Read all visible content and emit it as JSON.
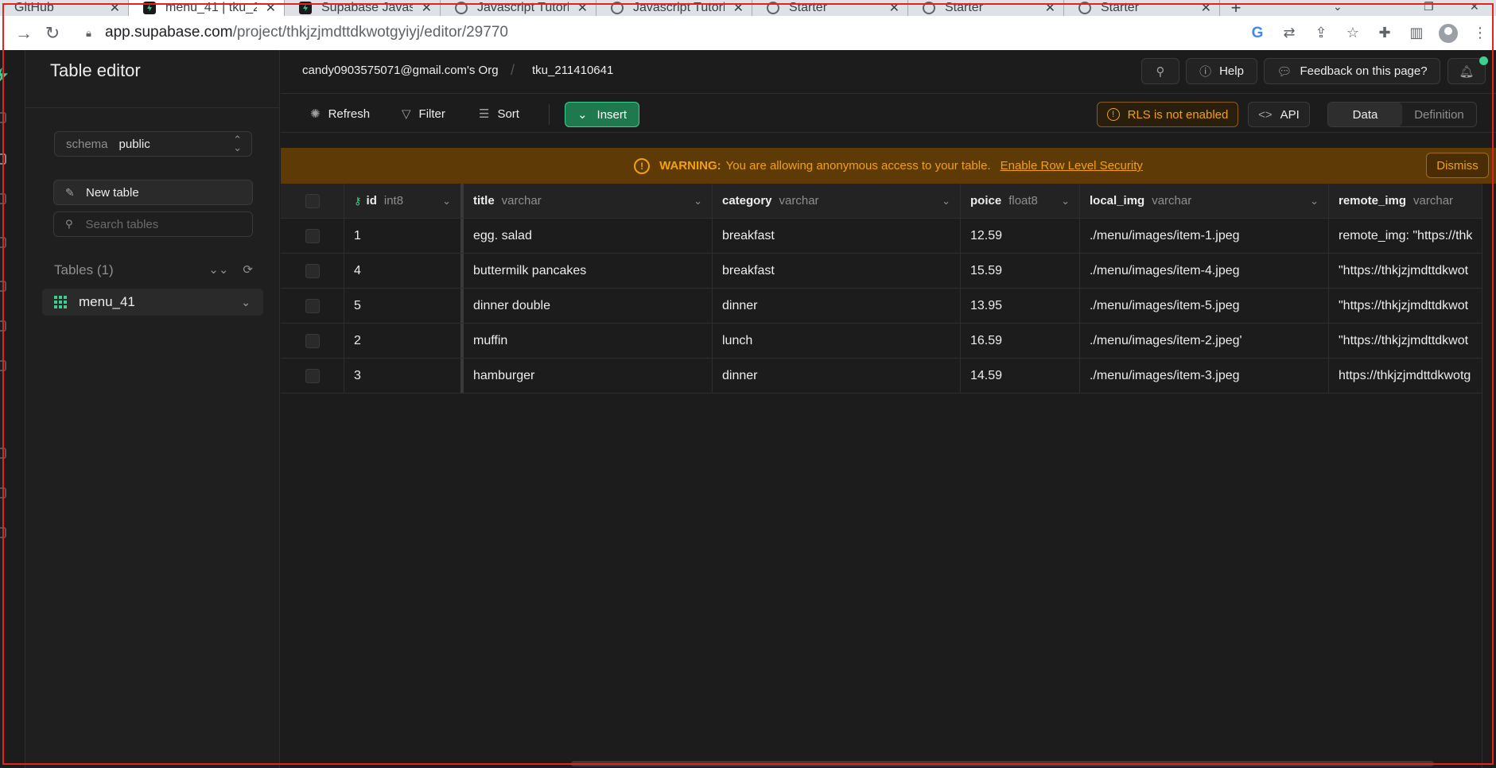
{
  "browser": {
    "tabs": [
      {
        "label": "GitHub",
        "icon": "github-icon"
      },
      {
        "label": "menu_41 | tku_2",
        "icon": "supabase-icon"
      },
      {
        "label": "Supabase Javasc",
        "icon": "supabase-icon"
      },
      {
        "label": "Javascript Tutori",
        "icon": "globe-icon"
      },
      {
        "label": "Javascript Tutori",
        "icon": "globe-icon"
      },
      {
        "label": "Starter",
        "icon": "globe-icon"
      },
      {
        "label": "Starter",
        "icon": "globe-icon"
      },
      {
        "label": "Starter",
        "icon": "globe-icon"
      }
    ],
    "active_tab": 1,
    "url_host": "app.supabase.com",
    "url_path": "/project/thkjzjmdttdkwotgyiyj/editor/29770"
  },
  "sidebar": {
    "title": "Table editor",
    "schema_key": "schema",
    "schema_value": "public",
    "new_table_label": "New table",
    "search_placeholder": "Search tables",
    "tables_heading": "Tables (1)",
    "tables": [
      {
        "name": "menu_41"
      }
    ]
  },
  "topbar": {
    "org": "candy0903575071@gmail.com's Org",
    "separator": "/",
    "project": "tku_211410641",
    "help_label": "Help",
    "feedback_label": "Feedback on this page?"
  },
  "actions": {
    "refresh_label": "Refresh",
    "filter_label": "Filter",
    "sort_label": "Sort",
    "insert_label": "Insert",
    "rls_label": "RLS is not enabled",
    "api_label": "API",
    "view_data": "Data",
    "view_definition": "Definition"
  },
  "warning": {
    "strong": "WARNING:",
    "message": "You are allowing anonymous access to your table.",
    "link": "Enable Row Level Security",
    "dismiss_label": "Dismiss"
  },
  "columns": [
    {
      "name": "id",
      "type": "int8"
    },
    {
      "name": "title",
      "type": "varchar"
    },
    {
      "name": "category",
      "type": "varchar"
    },
    {
      "name": "poice",
      "type": "float8"
    },
    {
      "name": "local_img",
      "type": "varchar"
    },
    {
      "name": "remote_img",
      "type": "varchar"
    }
  ],
  "rows": [
    [
      "1",
      "egg. salad",
      "breakfast",
      "12.59",
      "./menu/images/item-1.jpeg",
      "remote_img: \"https://thk"
    ],
    [
      "4",
      "buttermilk pancakes",
      "breakfast",
      "15.59",
      "./menu/images/item-4.jpeg",
      "\"https://thkjzjmdttdkwot"
    ],
    [
      "5",
      "dinner double",
      "dinner",
      "13.95",
      "./menu/images/item-5.jpeg",
      "\"https://thkjzjmdttdkwot"
    ],
    [
      "2",
      "muffin",
      "lunch",
      "16.59",
      "./menu/images/item-2.jpeg'",
      "\"https://thkjzjmdttdkwot"
    ],
    [
      "3",
      "hamburger",
      "dinner",
      "14.59",
      "./menu/images/item-3.jpeg",
      "https://thkjzjmdttdkwotg"
    ]
  ],
  "colors": {
    "brand_green": "#3ecf8e",
    "warning_amber": "#f1a10d",
    "warning_bg": "#5e3a07",
    "app_bg": "#1c1c1c"
  }
}
